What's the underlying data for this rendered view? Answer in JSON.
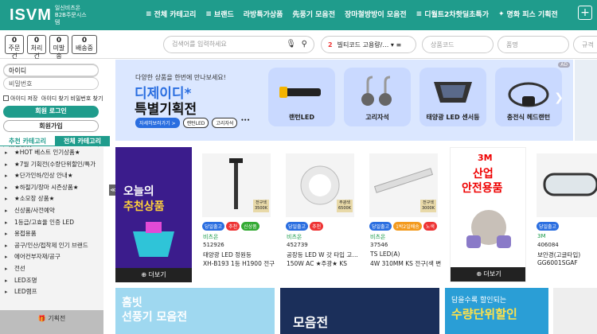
{
  "header": {
    "logo": "ISVM",
    "logo_sub": "일신비츠온 B2B주문시스템",
    "nav": [
      "전체 카테고리",
      "브랜드",
      "라방특가상품",
      "先풍기 모음전",
      "장마철방방이 모음전",
      "디월트2차핫딜초특가",
      "명화 피스 기획전"
    ],
    "plus": "+"
  },
  "counters": [
    {
      "value": "0",
      "label": "주문건"
    },
    {
      "value": "0",
      "label": "처리건"
    },
    {
      "value": "0",
      "label": "미발송"
    },
    {
      "value": "0",
      "label": "배송중"
    }
  ],
  "search": {
    "placeholder": "검색어를 입력하세요"
  },
  "ranking": {
    "rank": "2",
    "text": "빌티코드 고용량/…",
    "icons": "▾ ≡"
  },
  "fields": {
    "product_code": "상품코드",
    "product_name": "품명",
    "spec": "규격"
  },
  "login": {
    "id": "아이디",
    "password": "비밀번호",
    "remember": "아이디 저장",
    "find": "아이디 찾기 비밀번호 찾기",
    "login_button": "회원 로그인",
    "join_button": "회원가입"
  },
  "tabs": [
    "추천 카테고리",
    "전체 카테고리"
  ],
  "categories": [
    "★HOT 베스트 인기상품★",
    "★7월 기획전(수량단위할인/특가",
    "★단가인하/인상 안내★",
    "★하절기/장마 시즌상품★",
    "★소모장 상품★",
    "신상품/사전예약",
    "1등급/고효율 인증 LED",
    "용접용품",
    "공구/인산/접착제 인기 브랜드",
    "에어컨부자재/공구",
    "전선",
    "LED조명",
    "LED램프"
  ],
  "gift": "기획전",
  "toggle": "≪",
  "banner": {
    "subtitle": "다양한 상품을 한번에 만나보세요!",
    "title1": "디제이디*",
    "title2": "특별기획전",
    "pills": [
      "자세히보러가기 >",
      "랜턴LED",
      "고리자석"
    ],
    "pill_more": "•••",
    "cards": [
      "랜턴LED",
      "고리자석",
      "태양광 LED 센서등",
      "충전식 헤드랜턴"
    ],
    "ad": "AD",
    "arrow": "❯"
  },
  "promo": {
    "line1": "오늘의",
    "line2": "추천상품",
    "more": "⊕ 더보기"
  },
  "products": [
    {
      "tags": [
        [
          "당일출고",
          "tb"
        ],
        [
          "추천",
          "tr"
        ],
        [
          "신상품",
          "tg"
        ]
      ],
      "brand": "비츠온",
      "code": "512926",
      "name": "XH-B193 1등 H1900 전구…",
      "badge": "전구색 3500K"
    },
    {
      "tags": [
        [
          "당일출고",
          "tb"
        ],
        [
          "추천",
          "tr"
        ]
      ],
      "brand": "비츠온",
      "code": "452739",
      "name": "150W AC ★주광★ KS",
      "badge": "주광색 6500K"
    },
    {
      "tags": [
        [
          "당일출고",
          "tb"
        ],
        [
          "1박2일배송",
          "to"
        ],
        [
          "노색",
          "tr"
        ]
      ],
      "brand": "비츠온",
      "code": "37546",
      "name": "4W 310MM KS 전구(색 변…",
      "badge": "전구색 3000K"
    },
    {
      "tags": [
        [
          "당일출고",
          "tb"
        ]
      ],
      "brand": "3M",
      "code": "406084",
      "name": "보안경(고글타입)",
      "badge": ""
    },
    {
      "tags": [],
      "brand": "3M",
      "code": "406084",
      "name": "GG6001SGAF",
      "badge": ""
    }
  ],
  "names2": {
    "p1": "태양광 LED 정원등",
    "p2": "공장등 LED W 갓 타입 고…",
    "p3": "TS LED(A)"
  },
  "safety": {
    "line1": "산업",
    "line2": "안전용품",
    "brand": "3M",
    "more": "⊕ 더보기"
  },
  "bottom": {
    "b1a": "홈빗",
    "b1b": "선풍기 모음전",
    "b2": "모음전",
    "b3a": "담을수록 할인되는",
    "b3b": "수량단위할인"
  }
}
